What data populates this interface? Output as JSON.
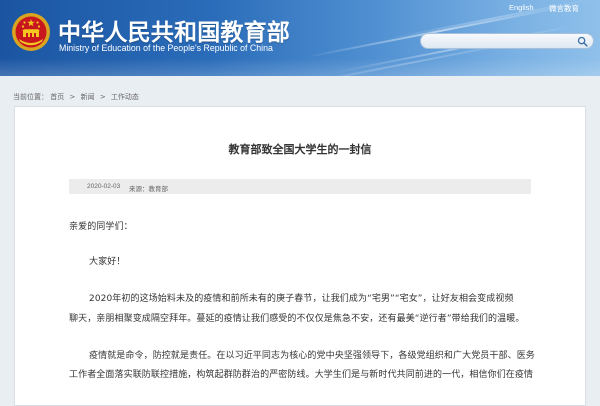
{
  "header": {
    "title": "中华人民共和国教育部",
    "subtitle": "Ministry of Education of the People's Republic of China",
    "links": [
      "English",
      "微言教育"
    ],
    "colors": {
      "banner_dark": "#1b55a2",
      "banner_light": "#8fc0ea",
      "text": "#ffffff"
    }
  },
  "icons": {
    "logo": "national-emblem-icon",
    "search": "search-icon"
  },
  "breadcrumb": {
    "label": "当前位置：",
    "items": [
      "首页",
      "新闻",
      "工作动态"
    ],
    "separator": ">"
  },
  "article": {
    "title": "教育部致全国大学生的一封信",
    "date": "2020-02-03",
    "source": "来源：教育部",
    "salutation": "亲爱的同学们：",
    "greeting": "大家好！",
    "paragraphs": [
      {
        "lines": [
          "2020年初的这场始料未及的疫情和前所未有的庚子春节，让我们成为“宅男”“宅女”，让好友相会变成视频",
          "聊天，亲朋相聚变成隔空拜年。蔓延的疫情让我们感受的不仅仅是焦急不安，还有最美“逆行者”带给我们的温暖。"
        ]
      },
      {
        "lines": [
          "疫情就是命令，防控就是责任。在以习近平同志为核心的党中央坚强领导下，各级党组织和广大党员干部、医务",
          "工作者全面落实联防联控措施，构筑起群防群治的严密防线。大学生们是与新时代共同前进的一代，相信你们在疫情"
        ]
      }
    ]
  }
}
